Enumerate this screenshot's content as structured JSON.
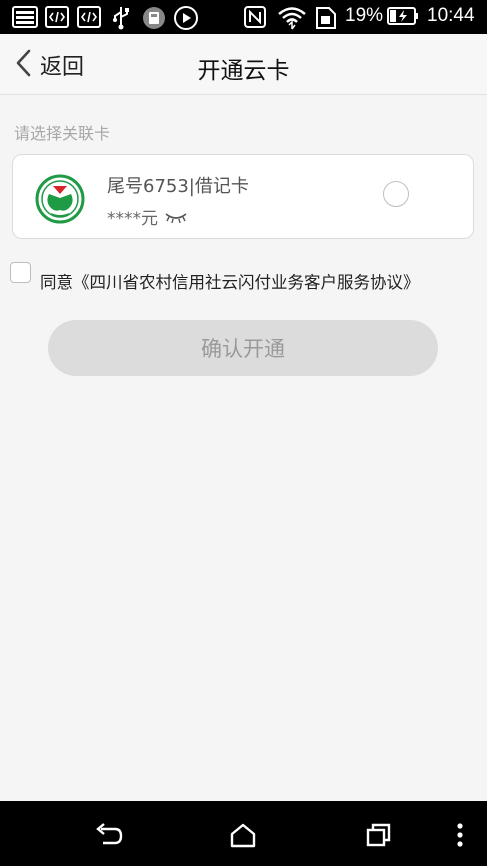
{
  "status_bar": {
    "battery_percent": "19%",
    "time": "10:44",
    "icons": [
      "image-icon",
      "code-icon",
      "code-icon",
      "usb-icon",
      "storage-icon",
      "play-icon",
      "nfc-icon",
      "wifi-icon",
      "sim-icon",
      "battery-charging-icon"
    ]
  },
  "header": {
    "back_label": "返回",
    "title": "开通云卡"
  },
  "section": {
    "label": "请选择关联卡"
  },
  "card": {
    "name": "尾号6753|借记卡",
    "balance": "****元",
    "logo_icon": "rural-credit-cooperative-logo",
    "eye_icon": "eye-closed-icon",
    "selected": false
  },
  "agreement": {
    "text": "同意《四川省农村信用社云闪付业务客户服务协议》",
    "checked": false
  },
  "confirm_button": {
    "label": "确认开通"
  },
  "colors": {
    "page_bg": "#f5f5f5",
    "logo_green": "#1f9a45",
    "logo_red": "#d6262b",
    "button_disabled_bg": "#dcdcdc",
    "button_disabled_text": "#9a9a9a"
  },
  "nav_bar": {
    "icons": [
      "back-icon",
      "home-icon",
      "recents-icon",
      "menu-icon"
    ]
  }
}
